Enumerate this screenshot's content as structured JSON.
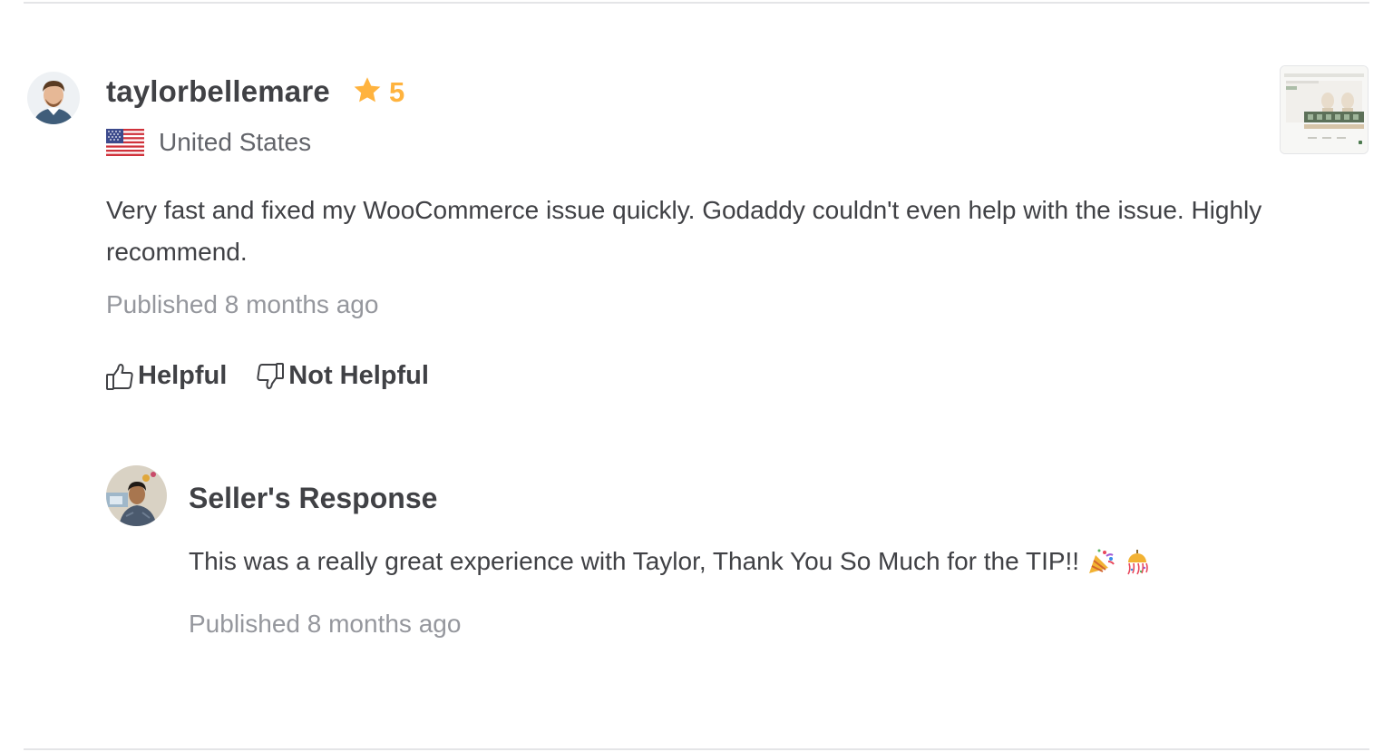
{
  "review": {
    "username": "taylorbellemare",
    "rating": "5",
    "country": "United States",
    "text": "Very fast and fixed my WooCommerce issue quickly. Godaddy couldn't even help with the issue. Highly recommend.",
    "published": "Published 8 months ago",
    "helpful_label": "Helpful",
    "not_helpful_label": "Not Helpful"
  },
  "seller_response": {
    "title": "Seller's Response",
    "text": "This was a really great experience with Taylor, Thank You So Much for the TIP!!",
    "published": "Published 8 months ago"
  },
  "icons": {
    "star": "star-icon",
    "flag": "us-flag-icon",
    "thumbs_up": "thumbs-up-icon",
    "thumbs_down": "thumbs-down-icon",
    "party_popper": "party-popper-icon",
    "confetti_ball": "confetti-ball-icon"
  },
  "colors": {
    "text_primary": "#404145",
    "text_secondary": "#62646a",
    "text_muted": "#95979d",
    "star": "#ffb33e",
    "divider": "#e4e5e7"
  }
}
